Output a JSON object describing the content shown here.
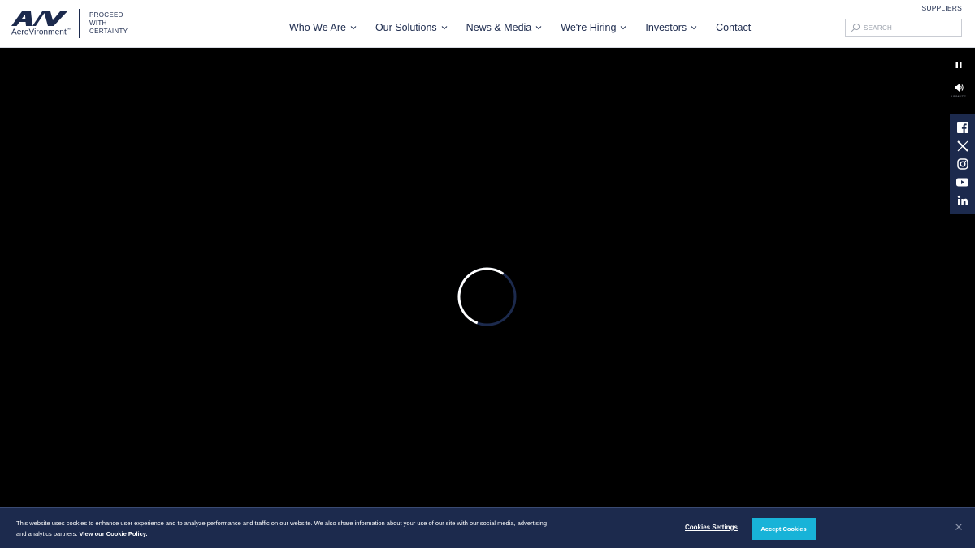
{
  "header": {
    "logo": {
      "mark_text": "AV",
      "wordmark": "AeroVironment",
      "trademark": "™"
    },
    "tagline": [
      "PROCEED",
      "WITH",
      "CERTAINTY"
    ],
    "utility_link": "SUPPLIERS",
    "search": {
      "placeholder": "SEARCH",
      "icon": "search-icon"
    },
    "nav": [
      {
        "label": "Who We Are",
        "has_dropdown": true
      },
      {
        "label": "Our Solutions",
        "has_dropdown": true
      },
      {
        "label": "News & Media",
        "has_dropdown": true
      },
      {
        "label": "We're Hiring",
        "has_dropdown": true
      },
      {
        "label": "Investors",
        "has_dropdown": true
      },
      {
        "label": "Contact",
        "has_dropdown": false
      }
    ]
  },
  "video": {
    "state": "loading",
    "controls": [
      {
        "icon": "pause-icon"
      },
      {
        "icon": "volume-icon",
        "caption": "UNMUTE"
      }
    ]
  },
  "social": [
    {
      "icon": "facebook-icon"
    },
    {
      "icon": "x-twitter-icon"
    },
    {
      "icon": "instagram-icon"
    },
    {
      "icon": "youtube-icon"
    },
    {
      "icon": "linkedin-icon"
    }
  ],
  "cookie_banner": {
    "text": "This website uses cookies to enhance user experience and to analyze performance and traffic on our website. We also share information about your use of our site with our social media, advertising and analytics partners.",
    "policy_link": "View our Cookie Policy.",
    "settings_label": "Cookies Settings",
    "accept_label": "Accept Cookies",
    "close_icon": "close-icon"
  },
  "colors": {
    "navy": "#1c2a4d",
    "accent": "#18b3d8",
    "header_bg": "#ffffff",
    "video_bg": "#000000"
  }
}
